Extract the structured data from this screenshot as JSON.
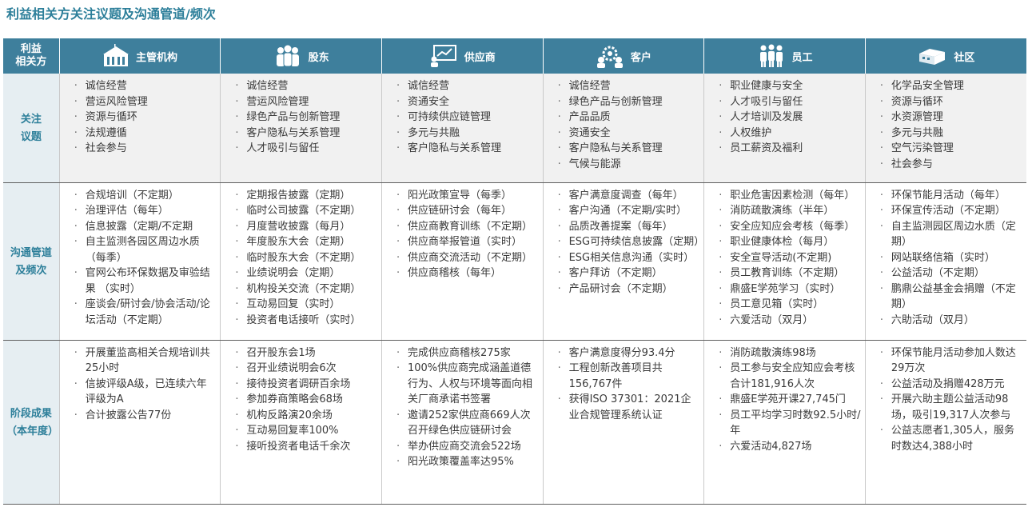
{
  "title": "利益相关方关注议题及沟通管道/频次",
  "corner_label": [
    "利益",
    "相关方"
  ],
  "stakeholders": [
    {
      "name": "主管机构",
      "icon": "government-building-icon"
    },
    {
      "name": "股东",
      "icon": "shareholders-icon"
    },
    {
      "name": "供应商",
      "icon": "supplier-presentation-icon"
    },
    {
      "name": "客户",
      "icon": "customer-gears-icon"
    },
    {
      "name": "员工",
      "icon": "employees-icon"
    },
    {
      "name": "社区",
      "icon": "community-icon"
    }
  ],
  "rows": [
    {
      "label": [
        "关注",
        "议题"
      ],
      "cells": [
        [
          "诚信经营",
          "营运风险管理",
          "资源与循环",
          "法规遵循",
          "社会参与"
        ],
        [
          "诚信经营",
          "营运风险管理",
          "绿色产品与创新管理",
          "客户隐私与关系管理",
          "人才吸引与留任"
        ],
        [
          "诚信经营",
          "资通安全",
          "可持续供应链管理",
          "多元与共融",
          "客户隐私与关系管理"
        ],
        [
          "诚信经营",
          "绿色产品与创新管理",
          "产品品质",
          "资通安全",
          "客户隐私与关系管理",
          "气候与能源"
        ],
        [
          "职业健康与安全",
          "人才吸引与留任",
          "人才培训及发展",
          "人权维护",
          "员工薪资及福利"
        ],
        [
          "化学品安全管理",
          "资源与循环",
          "水资源管理",
          "多元与共融",
          "空气污染管理",
          "社会参与"
        ]
      ]
    },
    {
      "label": [
        "沟通管道",
        "及频次"
      ],
      "cells": [
        [
          "合规培训（不定期）",
          "治理评估（每年）",
          "信息披露（定期/不定期",
          "自主监测各园区周边水质（每季）",
          "官网公布环保数据及审验结果 （实时）",
          "座谈会/研讨会/协会活动/论坛活动（不定期）"
        ],
        [
          "定期报告披露（定期）",
          "临时公司披露（不定期）",
          "月度营收披露（每月）",
          "年度股东大会（定期）",
          "临时股东大会（不定期）",
          "业绩说明会（定期）",
          "机构投关交流（不定期）",
          "互动易回复（实时）",
          "投资者电话接听（实时）"
        ],
        [
          "阳光政策宣导（每季）",
          "供应链研讨会（每年）",
          "供应商教育训练（不定期）",
          "供应商举报管道（实时）",
          "供应商交流活动（不定期）",
          "供应商稽核（每年）"
        ],
        [
          "客户满意度调查（每年）",
          "客户沟通（不定期/实时）",
          "品质改善提案（每年）",
          "ESG可持续信息披露（定期）",
          "ESG相关信息沟通（实时）",
          "客户拜访（不定期）",
          "产品研讨会（不定期）"
        ],
        [
          "职业危害因素检测（每年）",
          "消防疏散演练（半年）",
          "安全应知应会考核（每季）",
          "职业健康体检（每月）",
          "安全宣导活动(不定期)",
          "员工教育训练（不定期）",
          "鼎盛E学苑学习（实时）",
          "员工意见箱（实时）",
          "六爱活动（双月）"
        ],
        [
          "环保节能月活动（每年）",
          "环保宣传活动（不定期）",
          "自主监测园区周边水质（定期）",
          "网站联络信箱（实时）",
          "公益活动（不定期）",
          "鹏鼎公益基金会捐赠（不定期）",
          "六助活动（双月）"
        ]
      ]
    },
    {
      "label": [
        "阶段成果",
        "（本年度）"
      ],
      "cells": [
        [
          "开展董监高相关合规培训共25小时",
          "信披评级A级，已连续六年评级为A",
          "合计披露公告77份"
        ],
        [
          "召开股东会1场",
          "召开业绩说明会6次",
          "接待投资者调研百余场",
          "参加券商策略会68场",
          "机构反路演20余场",
          "互动易回复率100%",
          "接听投资者电话千余次"
        ],
        [
          "完成供应商稽核275家",
          "100%供应商完成涵盖道德行为、人权与环境等面向相关厂商承诺书签署",
          "邀请252家供应商669人次召开绿色供应链研讨会",
          "举办供应商交流会522场",
          "阳光政策覆盖率达95%"
        ],
        [
          "客户满意度得分93.4分",
          "工程创新改善项目共156,767件",
          "获得ISO 37301：2021企业合规管理系统认证"
        ],
        [
          "消防疏散演练98场",
          "员工参与安全应知应会考核合计181,916人次",
          "鼎盛E学苑开课27,745门",
          "员工平均学习时数92.5小时/年",
          "六爱活动4,827场"
        ],
        [
          "环保节能月活动参加人数达29万次",
          "公益活动及捐赠428万元",
          "开展六助主题公益活动98场，吸引19,317人次参与",
          "公益志愿者1,305人，服务时数达4,388小时"
        ]
      ]
    }
  ]
}
